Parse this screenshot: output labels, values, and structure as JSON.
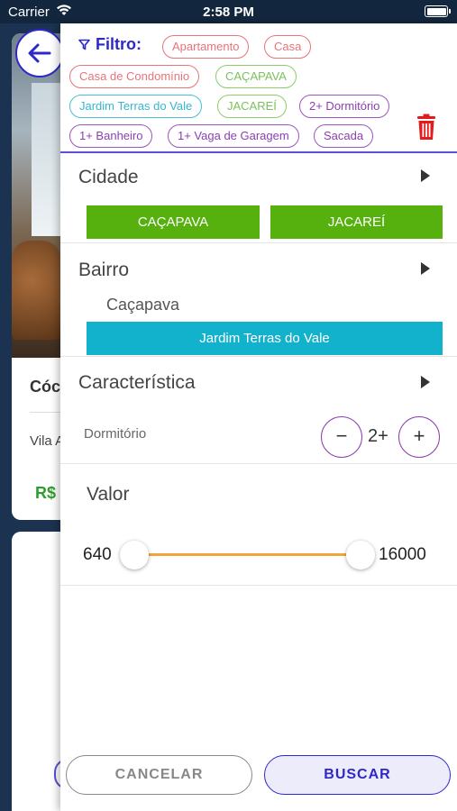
{
  "status": {
    "carrier": "Carrier",
    "time": "2:58 PM"
  },
  "background": {
    "code_label": "Cóc",
    "neighborhood": "Vila A",
    "price": "R$"
  },
  "filter": {
    "title": "Filtro:",
    "chips": [
      {
        "label": "Apartamento",
        "color": "red"
      },
      {
        "label": "Casa",
        "color": "red"
      },
      {
        "label": "Casa de Condomínio",
        "color": "red"
      },
      {
        "label": "CAÇAPAVA",
        "color": "green"
      },
      {
        "label": "Jardim Terras do Vale",
        "color": "cyan"
      },
      {
        "label": "JACAREÍ",
        "color": "green"
      },
      {
        "label": "2+ Dormitório",
        "color": "purple"
      },
      {
        "label": "1+ Banheiro",
        "color": "purple"
      },
      {
        "label": "1+ Vaga de Garagem",
        "color": "purple"
      },
      {
        "label": "Sacada",
        "color": "purple"
      }
    ]
  },
  "cidade": {
    "title": "Cidade",
    "options": [
      "CAÇAPAVA",
      "JACAREÍ"
    ]
  },
  "bairro": {
    "title": "Bairro",
    "city": "Caçapava",
    "selected": "Jardim Terras do Vale"
  },
  "caracteristica": {
    "title": "Característica",
    "dormitorio_label": "Dormitório",
    "minus": "−",
    "value": "2+",
    "plus": "+"
  },
  "valor": {
    "title": "Valor",
    "min": "640",
    "max": "16000"
  },
  "actions": {
    "cancel": "CANCELAR",
    "search": "BUSCAR"
  },
  "colors": {
    "accent": "#2f28c8",
    "green": "#56b00e",
    "cyan": "#12b1cc",
    "purple": "#8d3fb0",
    "slider": "#f0a63a",
    "delete": "#e31b1b"
  }
}
